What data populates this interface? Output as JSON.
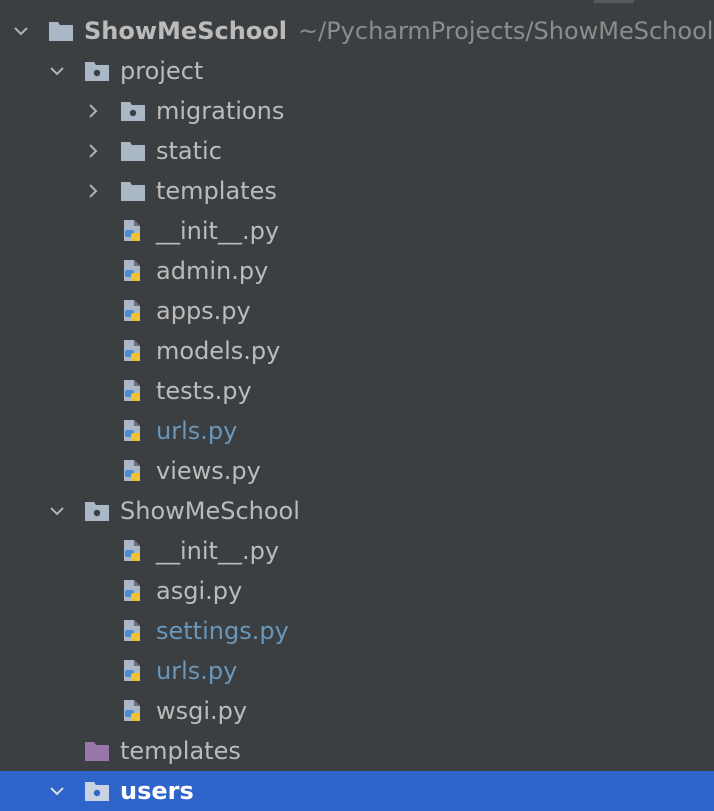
{
  "root": {
    "name": "ShowMeSchool",
    "path": "~/PycharmProjects/ShowMeSchool"
  },
  "project": {
    "name": "project",
    "folders": [
      {
        "name": "migrations"
      },
      {
        "name": "static"
      },
      {
        "name": "templates"
      }
    ],
    "files": [
      {
        "name": "__init__.py"
      },
      {
        "name": "admin.py"
      },
      {
        "name": "apps.py"
      },
      {
        "name": "models.py"
      },
      {
        "name": "tests.py"
      },
      {
        "name": "urls.py"
      },
      {
        "name": "views.py"
      }
    ]
  },
  "package": {
    "name": "ShowMeSchool",
    "files": [
      {
        "name": "__init__.py"
      },
      {
        "name": "asgi.py"
      },
      {
        "name": "settings.py"
      },
      {
        "name": "urls.py"
      },
      {
        "name": "wsgi.py"
      }
    ]
  },
  "templates_dir": {
    "name": "templates"
  },
  "users": {
    "name": "users"
  },
  "icons": {
    "expand": "chevron-down-icon",
    "collapse": "chevron-right-icon",
    "folder": "folder-icon",
    "python_package": "package-folder-icon",
    "templates_folder": "templates-folder-icon",
    "python_file": "python-file-icon"
  },
  "colors": {
    "background": "#3c3f41",
    "text": "#bbbbbb",
    "modified_text": "#6897bb",
    "path_text": "#8c8c8c",
    "selection": "#2f65ca",
    "folder": "#a9b7c6",
    "templates_folder": "#9876aa"
  }
}
